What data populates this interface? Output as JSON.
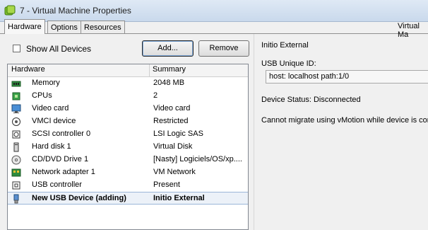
{
  "window": {
    "title": "7 - Virtual Machine Properties",
    "vm_label": "Virtual Ma"
  },
  "tabs": [
    {
      "label": "Hardware",
      "active": true
    },
    {
      "label": "Options",
      "active": false
    },
    {
      "label": "Resources",
      "active": false
    }
  ],
  "toolbar": {
    "show_all_label": "Show All Devices",
    "show_all_checked": false,
    "add_label": "Add...",
    "remove_label": "Remove"
  },
  "table": {
    "headers": [
      "Hardware",
      "Summary"
    ],
    "rows": [
      {
        "name": "Memory",
        "summary": "2048 MB",
        "icon": "memory-icon"
      },
      {
        "name": "CPUs",
        "summary": "2",
        "icon": "cpu-icon"
      },
      {
        "name": "Video card",
        "summary": "Video card",
        "icon": "monitor-icon"
      },
      {
        "name": "VMCI device",
        "summary": "Restricted",
        "icon": "vmci-icon"
      },
      {
        "name": "SCSI controller 0",
        "summary": "LSI Logic SAS",
        "icon": "scsi-icon"
      },
      {
        "name": "Hard disk 1",
        "summary": "Virtual Disk",
        "icon": "disk-icon"
      },
      {
        "name": "CD/DVD Drive 1",
        "summary": "[Nasty] Logiciels/OS/xp....",
        "icon": "cd-icon"
      },
      {
        "name": "Network adapter 1",
        "summary": "VM Network",
        "icon": "network-icon"
      },
      {
        "name": "USB controller",
        "summary": "Present",
        "icon": "usb-controller-icon"
      },
      {
        "name": "New USB Device (adding)",
        "summary": "Initio External",
        "icon": "usb-device-icon",
        "selected": true
      }
    ]
  },
  "details": {
    "device_title": "Initio External",
    "usb_id_label": "USB Unique ID:",
    "usb_id_value": "host: localhost path:1/0",
    "status": "Device Status: Disconnected",
    "warning": "Cannot migrate using vMotion while device is conn"
  },
  "colors": {
    "selection": "#ecf1f8",
    "selection_border": "#9bb6d8",
    "titlebar": "#dfe9f5"
  }
}
